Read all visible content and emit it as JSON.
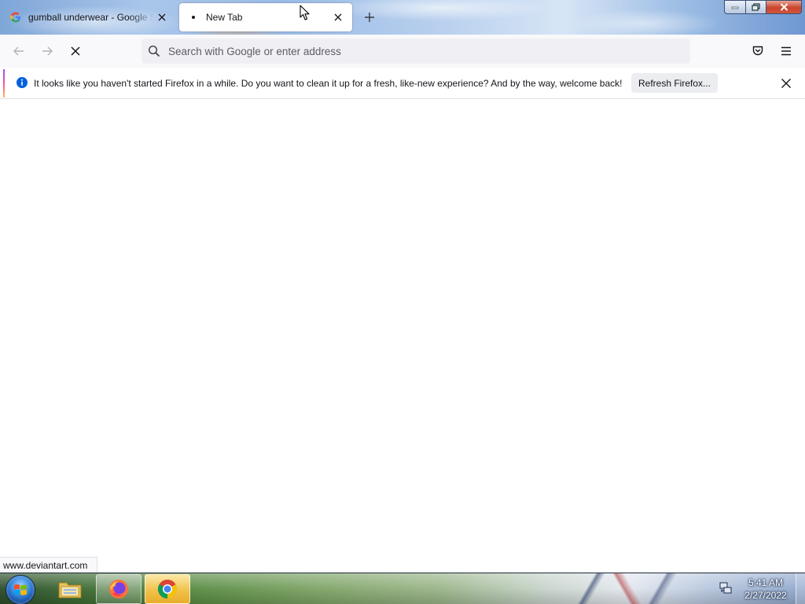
{
  "tabs": [
    {
      "title": "gumball underwear - Google Se",
      "favicon": "google-g-icon",
      "active": false
    },
    {
      "title": "New Tab",
      "favicon": "loading-dot-icon",
      "active": true
    }
  ],
  "navbar": {
    "back_icon": "back-arrow-icon",
    "forward_icon": "forward-arrow-icon",
    "stop_icon": "stop-x-icon",
    "url_placeholder": "Search with Google or enter address",
    "url_value": "",
    "right_icons": [
      "pocket-icon",
      "hamburger-menu-icon"
    ]
  },
  "notification": {
    "message": "It looks like you haven't started Firefox in a while. Do you want to clean it up for a fresh, like-new experience? And by the way, welcome back!",
    "button_label": "Refresh Firefox...",
    "accent_colors": [
      "#9059ff",
      "#ff4aa2",
      "#ffbd4f"
    ],
    "info_color": "#0060df"
  },
  "status_bar": {
    "text": "www.deviantart.com"
  },
  "taskbar": {
    "pinned_apps": [
      "windows-explorer-icon",
      "firefox-icon",
      "chrome-icon"
    ],
    "clock": {
      "time": "5:41 AM",
      "date": "2/27/2022"
    }
  }
}
